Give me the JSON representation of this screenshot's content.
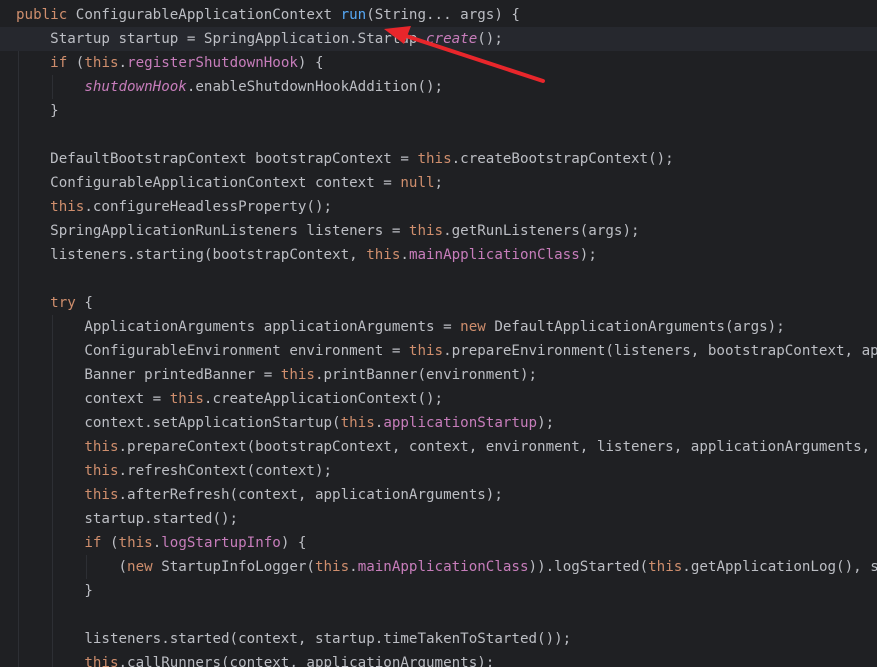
{
  "editor": {
    "colors": {
      "background": "#1f2023",
      "current_line": "#26282e",
      "text": "#bcbec4",
      "keyword": "#cf8e6d",
      "field": "#c77dbb",
      "method_declaration": "#56a8f5",
      "annotation_arrow": "#e8262b"
    },
    "lines": [
      [
        {
          "t": "public",
          "c": "kw"
        },
        {
          "t": " ConfigurableApplicationContext "
        },
        {
          "t": "run",
          "c": "fn"
        },
        {
          "t": "(String... args) {"
        }
      ],
      [
        {
          "t": "    Startup startup = SpringApplication.Startup."
        },
        {
          "t": "create",
          "c": "st-field"
        },
        {
          "t": "();"
        }
      ],
      [
        {
          "t": "    "
        },
        {
          "t": "if",
          "c": "kw"
        },
        {
          "t": " ("
        },
        {
          "t": "this",
          "c": "kw"
        },
        {
          "t": "."
        },
        {
          "t": "registerShutdownHook",
          "c": "field"
        },
        {
          "t": ") {"
        }
      ],
      [
        {
          "t": "        "
        },
        {
          "t": "shutdownHook",
          "c": "st-field"
        },
        {
          "t": ".enableShutdownHookAddition();"
        }
      ],
      [
        {
          "t": "    }"
        }
      ],
      [
        {
          "t": ""
        }
      ],
      [
        {
          "t": "    DefaultBootstrapContext bootstrapContext = "
        },
        {
          "t": "this",
          "c": "kw"
        },
        {
          "t": ".createBootstrapContext();"
        }
      ],
      [
        {
          "t": "    ConfigurableApplicationContext context = "
        },
        {
          "t": "null",
          "c": "kw"
        },
        {
          "t": ";"
        }
      ],
      [
        {
          "t": "    "
        },
        {
          "t": "this",
          "c": "kw"
        },
        {
          "t": ".configureHeadlessProperty();"
        }
      ],
      [
        {
          "t": "    SpringApplicationRunListeners listeners = "
        },
        {
          "t": "this",
          "c": "kw"
        },
        {
          "t": ".getRunListeners(args);"
        }
      ],
      [
        {
          "t": "    listeners.starting(bootstrapContext, "
        },
        {
          "t": "this",
          "c": "kw"
        },
        {
          "t": "."
        },
        {
          "t": "mainApplicationClass",
          "c": "field"
        },
        {
          "t": ");"
        }
      ],
      [
        {
          "t": ""
        }
      ],
      [
        {
          "t": "    "
        },
        {
          "t": "try",
          "c": "kw"
        },
        {
          "t": " {"
        }
      ],
      [
        {
          "t": "        ApplicationArguments applicationArguments = "
        },
        {
          "t": "new",
          "c": "kw"
        },
        {
          "t": " DefaultApplicationArguments(args);"
        }
      ],
      [
        {
          "t": "        ConfigurableEnvironment environment = "
        },
        {
          "t": "this",
          "c": "kw"
        },
        {
          "t": ".prepareEnvironment(listeners, bootstrapContext, ap"
        }
      ],
      [
        {
          "t": "        Banner printedBanner = "
        },
        {
          "t": "this",
          "c": "kw"
        },
        {
          "t": ".printBanner(environment);"
        }
      ],
      [
        {
          "t": "        context = "
        },
        {
          "t": "this",
          "c": "kw"
        },
        {
          "t": ".createApplicationContext();"
        }
      ],
      [
        {
          "t": "        context.setApplicationStartup("
        },
        {
          "t": "this",
          "c": "kw"
        },
        {
          "t": "."
        },
        {
          "t": "applicationStartup",
          "c": "field"
        },
        {
          "t": ");"
        }
      ],
      [
        {
          "t": "        "
        },
        {
          "t": "this",
          "c": "kw"
        },
        {
          "t": ".prepareContext(bootstrapContext, context, environment, listeners, applicationArguments,"
        }
      ],
      [
        {
          "t": "        "
        },
        {
          "t": "this",
          "c": "kw"
        },
        {
          "t": ".refreshContext(context);"
        }
      ],
      [
        {
          "t": "        "
        },
        {
          "t": "this",
          "c": "kw"
        },
        {
          "t": ".afterRefresh(context, applicationArguments);"
        }
      ],
      [
        {
          "t": "        startup.started();"
        }
      ],
      [
        {
          "t": "        "
        },
        {
          "t": "if",
          "c": "kw"
        },
        {
          "t": " ("
        },
        {
          "t": "this",
          "c": "kw"
        },
        {
          "t": "."
        },
        {
          "t": "logStartupInfo",
          "c": "field"
        },
        {
          "t": ") {"
        }
      ],
      [
        {
          "t": "            ("
        },
        {
          "t": "new",
          "c": "kw"
        },
        {
          "t": " StartupInfoLogger("
        },
        {
          "t": "this",
          "c": "kw"
        },
        {
          "t": "."
        },
        {
          "t": "mainApplicationClass",
          "c": "field"
        },
        {
          "t": ")).logStarted("
        },
        {
          "t": "this",
          "c": "kw"
        },
        {
          "t": ".getApplicationLog(), s"
        }
      ],
      [
        {
          "t": "        }"
        }
      ],
      [
        {
          "t": ""
        }
      ],
      [
        {
          "t": "        listeners.started(context, startup.timeTakenToStarted());"
        }
      ],
      [
        {
          "t": "        "
        },
        {
          "t": "this",
          "c": "kw"
        },
        {
          "t": ".callRunners(context, applicationArguments);"
        }
      ]
    ],
    "current_line_index": 1
  }
}
